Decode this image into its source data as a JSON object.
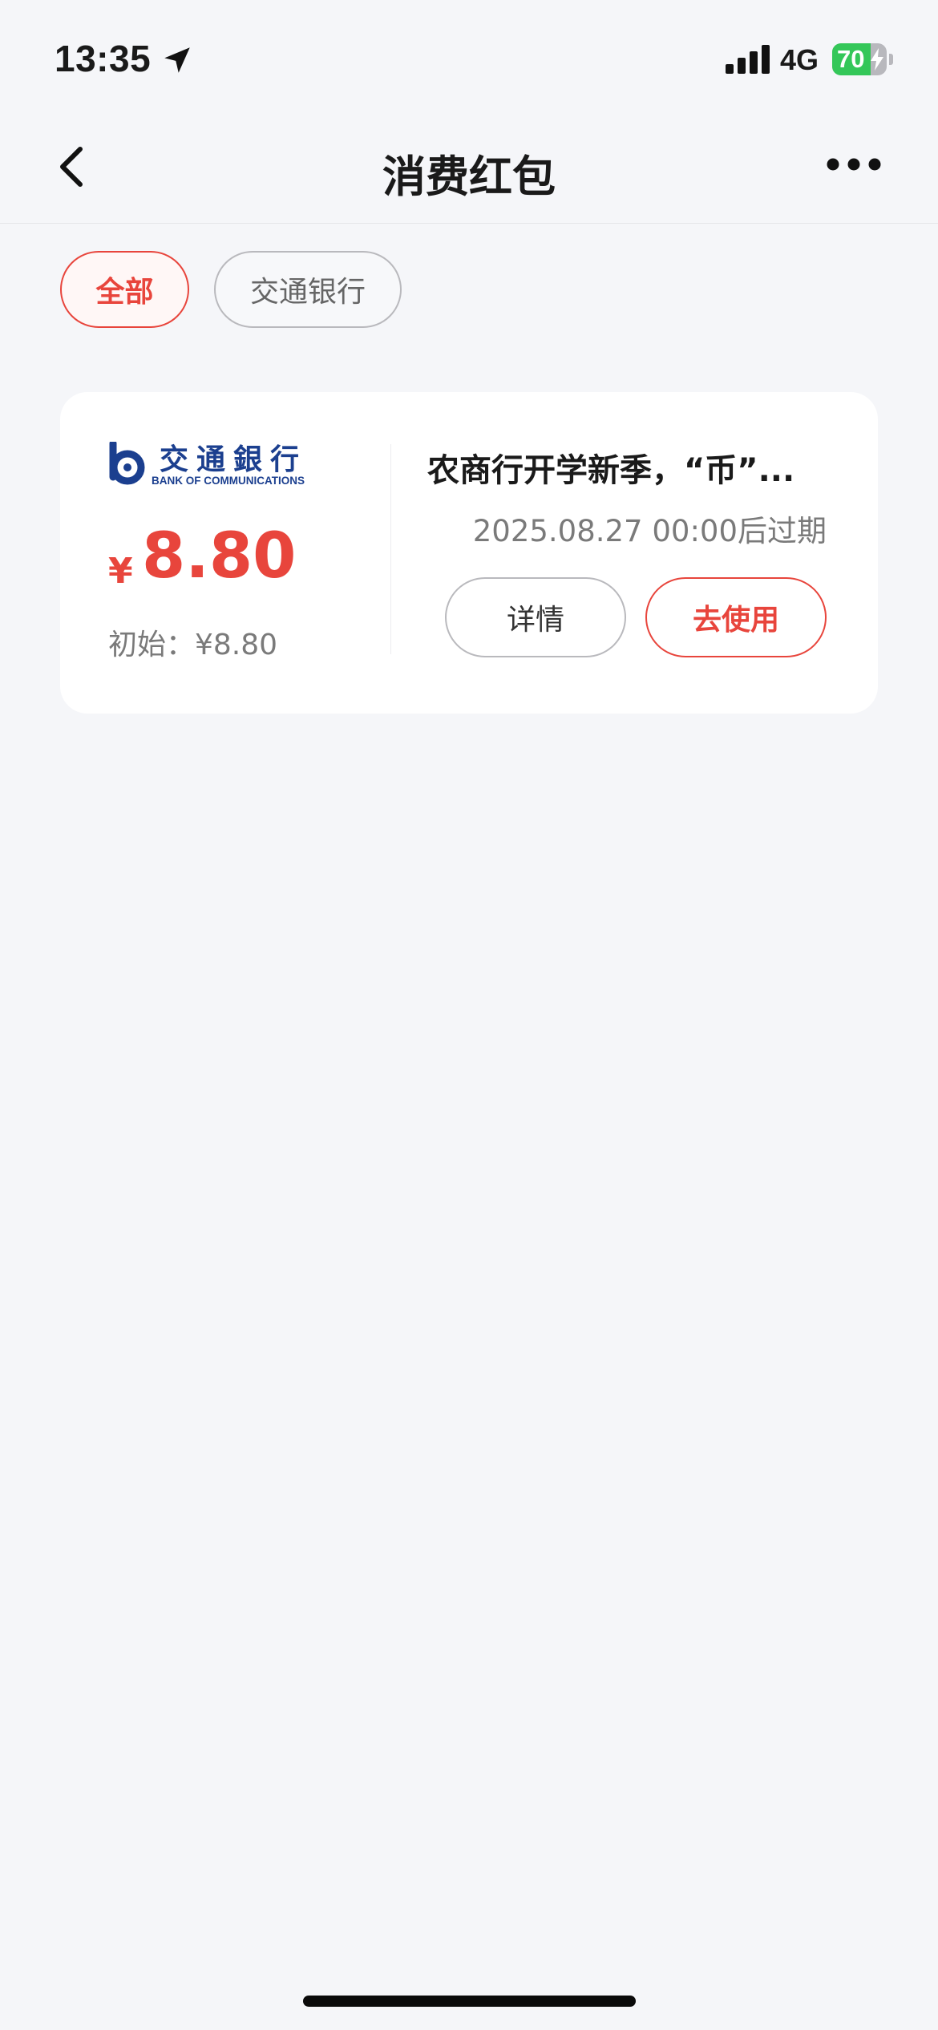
{
  "status_bar": {
    "time": "13:35",
    "network": "4G",
    "battery_percent": "70",
    "battery_level": 0.7
  },
  "nav": {
    "title": "消费红包"
  },
  "filters": [
    {
      "label": "全部",
      "selected": true
    },
    {
      "label": "交通银行",
      "selected": false
    }
  ],
  "coupon": {
    "bank_logo_cn": "交通銀行",
    "bank_logo_en": "BANK OF COMMUNICATIONS",
    "currency_symbol": "¥",
    "amount": "8.80",
    "initial_label": "初始：¥8.80",
    "title": "农商行开学新季，“币”...",
    "expire_text": "2025.08.27 00:00后过期",
    "details_label": "详情",
    "use_label": "去使用"
  },
  "colors": {
    "accent": "#e8453c",
    "background": "#f5f6f9",
    "card": "#ffffff",
    "battery_green": "#34c759",
    "bank_blue": "#1b3f8f"
  }
}
